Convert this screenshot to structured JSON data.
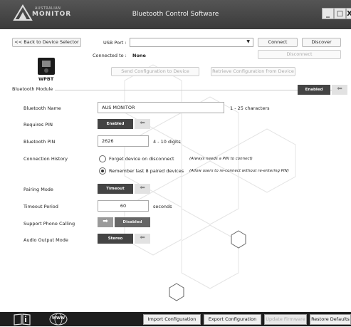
{
  "window": {
    "title": "Bluetooth Control Software",
    "logo_line1": "AUSTRALIAN",
    "logo_line2": "MONITOR",
    "minimize": "_",
    "maximize": "□",
    "close": "X"
  },
  "top": {
    "back_button": "<< Back to Device Selector",
    "usb_port_label": "USB Port :",
    "usb_port_value": "",
    "connect_button": "Connect",
    "discover_button": "Discover",
    "connected_to_label": "Connected to :",
    "connected_to_value": "None",
    "disconnect_button": "Disconnect",
    "device_name": "WPBT",
    "send_config_button": "Send Configuration to Device",
    "retrieve_config_button": "Retrieve Configuration from Device"
  },
  "module": {
    "group_title": "Bluetooth Module",
    "enabled_toggle": "Enabled",
    "bt_name_label": "Bluetooth Name",
    "bt_name_value": "AUS MONITOR",
    "bt_name_hint": "1 - 25 characters",
    "requires_pin_label": "Requires PIN",
    "requires_pin_toggle": "Enabled",
    "bt_pin_label": "Bluetooth PIN",
    "bt_pin_value": "2626",
    "bt_pin_hint": "4 - 10 digits",
    "conn_history_label": "Connection History",
    "option_forget": "Forget device on disconnect",
    "option_forget_note": "(Always needs a PIN to connect)",
    "option_remember": "Remember last 8 paired devices",
    "option_remember_note": "(Allow users to re-connect without re-entering PIN)",
    "pairing_mode_label": "Pairing Mode",
    "pairing_mode_toggle": "Timeout",
    "timeout_label": "Timeout Period",
    "timeout_value": "60",
    "timeout_unit": "seconds",
    "phone_label": "Support Phone Calling",
    "phone_toggle": "Disabled",
    "audio_label": "Audio Output Mode",
    "audio_toggle": "Stereo"
  },
  "bottom": {
    "manual_icon": "book-icon",
    "web_icon": "www-globe-icon",
    "web_text": "WWW",
    "import_button": "Import Configuration",
    "export_button": "Export Configuration",
    "update_button": "Update Firmware",
    "restore_button": "Restore Defaults"
  }
}
